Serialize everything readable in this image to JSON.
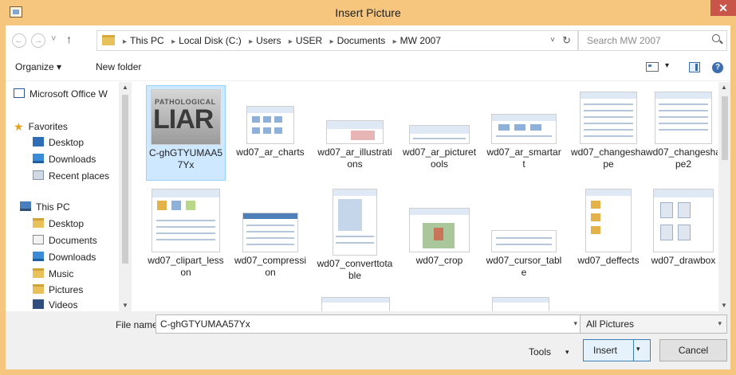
{
  "window": {
    "title": "Insert Picture",
    "close_glyph": "✕"
  },
  "nav": {
    "back_icon": "back-arrow-icon",
    "forward_icon": "forward-arrow-icon",
    "back_glyph": "←",
    "forward_glyph": "→",
    "recent_glyph": "˅",
    "up_glyph": "↑",
    "breadcrumbs": [
      "This PC",
      "Local Disk (C:)",
      "Users",
      "USER",
      "Documents",
      "MW 2007"
    ],
    "crumb_sep": "▸",
    "dropdown_glyph": "˅",
    "refresh_glyph": "↻",
    "search_placeholder": "Search MW 2007"
  },
  "toolbar": {
    "organize_label": "Organize ▾",
    "new_folder_label": "New folder",
    "view_arrow": "▾",
    "help_glyph": "?"
  },
  "navpane": {
    "items": [
      {
        "label": "Microsoft Office W",
        "icon": "word-icon"
      },
      {
        "label": "Favorites",
        "icon": "star-icon"
      },
      {
        "label": "Desktop",
        "icon": "desktop-icon"
      },
      {
        "label": "Downloads",
        "icon": "downloads-icon"
      },
      {
        "label": "Recent places",
        "icon": "recent-places-icon"
      },
      {
        "label": "This PC",
        "icon": "computer-icon"
      },
      {
        "label": "Desktop",
        "icon": "folder-icon"
      },
      {
        "label": "Documents",
        "icon": "documents-icon"
      },
      {
        "label": "Downloads",
        "icon": "downloads-icon"
      },
      {
        "label": "Music",
        "icon": "music-icon"
      },
      {
        "label": "Pictures",
        "icon": "pictures-icon"
      },
      {
        "label": "Videos",
        "icon": "videos-icon"
      }
    ],
    "star_glyph": "★"
  },
  "files": {
    "items": [
      {
        "name": "C-ghGTYUMAA57Yx",
        "selected": true
      },
      {
        "name": "wd07_ar_charts"
      },
      {
        "name": "wd07_ar_illustrations"
      },
      {
        "name": "wd07_ar_picturetools"
      },
      {
        "name": "wd07_ar_smartart"
      },
      {
        "name": "wd07_changeshape"
      },
      {
        "name": "wd07_changeshape2"
      },
      {
        "name": "wd07_clipart_lesson"
      },
      {
        "name": "wd07_compression"
      },
      {
        "name": "wd07_converttotable"
      },
      {
        "name": "wd07_crop"
      },
      {
        "name": "wd07_cursor_table"
      },
      {
        "name": "wd07_deffects"
      },
      {
        "name": "wd07_drawbox"
      }
    ],
    "liar_small": "PATHOLOGICAL",
    "liar_big": "LIAR"
  },
  "scroll": {
    "up": "▲",
    "down": "▼"
  },
  "bottom": {
    "file_name_label": "File name:",
    "file_name_value": "C-ghGTYUMAA57Yx",
    "dropdown_glyph": "▾",
    "file_type_value": "All Pictures",
    "tools_label": "Tools",
    "tools_arrow": "▾",
    "insert_label": "Insert",
    "cancel_label": "Cancel"
  }
}
